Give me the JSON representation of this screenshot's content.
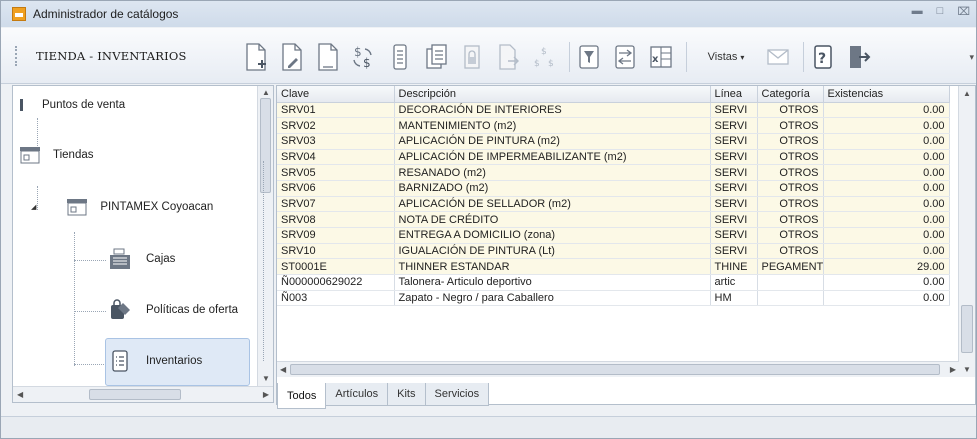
{
  "window": {
    "title": "Administrador de catálogos",
    "controls": [
      "minimize",
      "restore",
      "close"
    ]
  },
  "toolbar": {
    "title": "TIENDA - INVENTARIOS",
    "vistas_label": "Vistas",
    "icons": [
      "new-document-icon",
      "edit-document-icon",
      "blank-document-icon",
      "price-change-icon",
      "calculator-document-icon",
      "copy-document-icon",
      "locked-document-icon",
      "export-document-icon",
      "currency-document-icon",
      "filter-icon",
      "transfer-icon",
      "excel-icon",
      "mail-icon",
      "help-icon",
      "exit-icon"
    ]
  },
  "tree": {
    "items": [
      {
        "label": "Puntos de venta",
        "icon": "root-icon"
      },
      {
        "label": "Tiendas",
        "icon": "store-icon"
      },
      {
        "label": "PINTAMEX Coyoacan",
        "icon": "store-icon"
      },
      {
        "label": "Cajas",
        "icon": "cash-register-icon"
      },
      {
        "label": "Políticas de oferta",
        "icon": "offer-policy-icon"
      },
      {
        "label": "Inventarios",
        "icon": "inventory-list-icon"
      }
    ],
    "selected": "Inventarios"
  },
  "grid": {
    "columns": [
      "Clave",
      "Descripción",
      "Línea",
      "Categoría",
      "Existencias"
    ],
    "rows": [
      {
        "clave": "SRV01",
        "descripcion": "DECORACIÓN DE INTERIORES",
        "linea": "SERVI",
        "categoria": "OTROS",
        "existencias": "0.00"
      },
      {
        "clave": "SRV02",
        "descripcion": "MANTENIMIENTO (m2)",
        "linea": "SERVI",
        "categoria": "OTROS",
        "existencias": "0.00"
      },
      {
        "clave": "SRV03",
        "descripcion": "APLICACIÓN DE PINTURA (m2)",
        "linea": "SERVI",
        "categoria": "OTROS",
        "existencias": "0.00"
      },
      {
        "clave": "SRV04",
        "descripcion": "APLICACIÓN DE IMPERMEABILIZANTE (m2)",
        "linea": "SERVI",
        "categoria": "OTROS",
        "existencias": "0.00"
      },
      {
        "clave": "SRV05",
        "descripcion": "RESANADO (m2)",
        "linea": "SERVI",
        "categoria": "OTROS",
        "existencias": "0.00"
      },
      {
        "clave": "SRV06",
        "descripcion": "BARNIZADO (m2)",
        "linea": "SERVI",
        "categoria": "OTROS",
        "existencias": "0.00"
      },
      {
        "clave": "SRV07",
        "descripcion": "APLICACIÓN DE SELLADOR (m2)",
        "linea": "SERVI",
        "categoria": "OTROS",
        "existencias": "0.00"
      },
      {
        "clave": "SRV08",
        "descripcion": "NOTA DE CRÉDITO",
        "linea": "SERVI",
        "categoria": "OTROS",
        "existencias": "0.00"
      },
      {
        "clave": "SRV09",
        "descripcion": "ENTREGA A DOMICILIO (zona)",
        "linea": "SERVI",
        "categoria": "OTROS",
        "existencias": "0.00"
      },
      {
        "clave": "SRV10",
        "descripcion": "IGUALACIÓN DE PINTURA (Lt)",
        "linea": "SERVI",
        "categoria": "OTROS",
        "existencias": "0.00"
      },
      {
        "clave": "ST0001E",
        "descripcion": "THINNER ESTANDAR",
        "linea": "THINE",
        "categoria": "PEGAMENT",
        "existencias": "29.00"
      },
      {
        "clave": "Ñ000000629022",
        "descripcion": "Talonera- Articulo deportivo",
        "linea": "artic",
        "categoria": "",
        "existencias": "0.00"
      },
      {
        "clave": "Ñ003",
        "descripcion": "Zapato - Negro / para Caballero",
        "linea": "HM",
        "categoria": "",
        "existencias": "0.00"
      }
    ]
  },
  "tabs": [
    "Todos",
    "Artículos",
    "Kits",
    "Servicios"
  ],
  "active_tab": "Todos"
}
